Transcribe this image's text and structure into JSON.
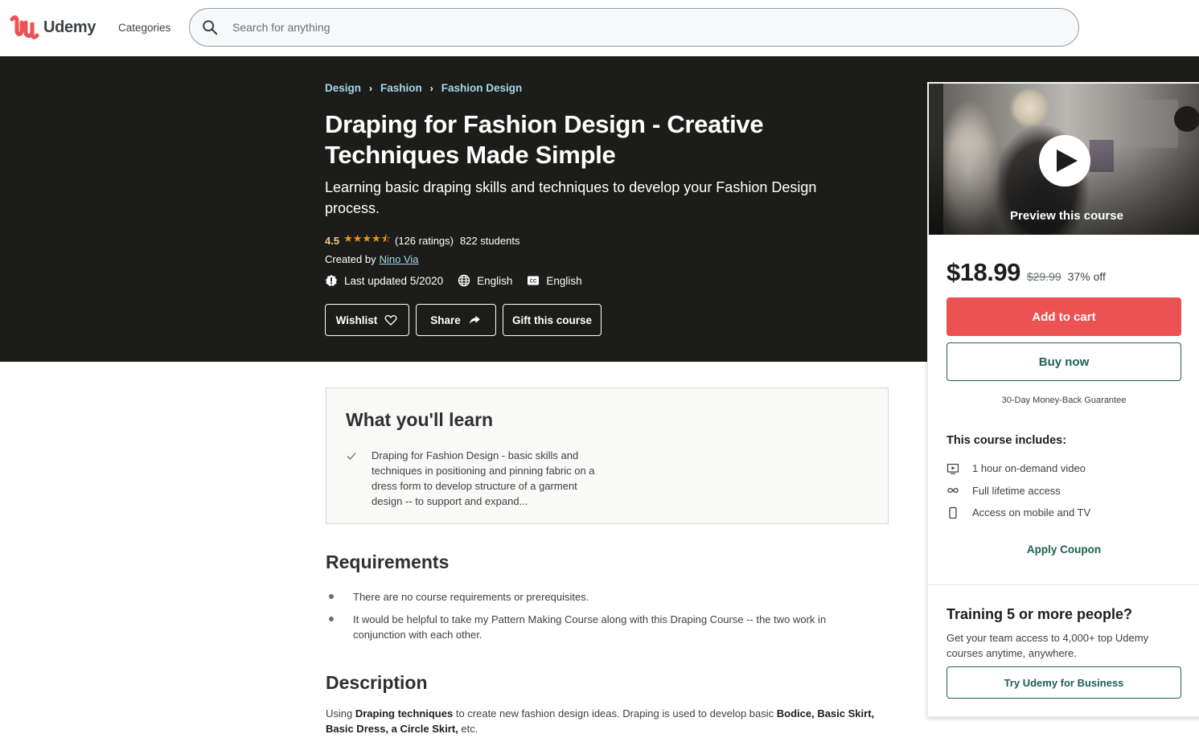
{
  "header": {
    "logo_text": "Udemy",
    "categories_label": "Categories",
    "search_placeholder": "Search for anything",
    "search_value": ""
  },
  "hero": {
    "breadcrumb": [
      "Design",
      "Fashion",
      "Fashion Design"
    ],
    "title": "Draping for Fashion Design - Creative Techniques Made Simple",
    "subtitle": "Learning basic draping skills and techniques to develop your Fashion Design process.",
    "rating": "4.5",
    "rating_value": 4.5,
    "rating_max": 5,
    "stars": "★★★★⯪",
    "ratings_count": "(126 ratings)",
    "students": "822 students",
    "created_by_label": "Created by",
    "instructor": "Nino Via",
    "last_updated": "Last updated 5/2020",
    "language": "English",
    "captions": "English",
    "buttons": {
      "wishlist": "Wishlist",
      "share": "Share",
      "gift": "Gift this course"
    }
  },
  "card": {
    "preview_label": "Preview this course",
    "price": "$18.99",
    "original_price": "$29.99",
    "discount": "37% off",
    "add_to_cart": "Add to cart",
    "buy_now": "Buy now",
    "guarantee": "30-Day Money-Back Guarantee",
    "includes_title": "This course includes:",
    "includes": [
      {
        "icon": "video-icon",
        "text": "1 hour on-demand video"
      },
      {
        "icon": "infinity-icon",
        "text": "Full lifetime access"
      },
      {
        "icon": "mobile-icon",
        "text": "Access on mobile and TV"
      }
    ],
    "apply_coupon": "Apply Coupon",
    "business_title": "Training 5 or more people?",
    "business_text": "Get your team access to 4,000+ top Udemy courses anytime, anywhere.",
    "business_button": "Try Udemy for Business"
  },
  "learn": {
    "title": "What you'll learn",
    "items": [
      "Draping for Fashion Design - basic skills and techniques in positioning and pinning fabric on a dress form to develop structure of a garment design -- to support and expand..."
    ]
  },
  "requirements": {
    "title": "Requirements",
    "items": [
      "There are no course requirements or prerequisites.",
      "It would be helpful to take my Pattern Making Course along with this Draping Course -- the two work in conjunction with each other."
    ]
  },
  "description": {
    "title": "Description",
    "parts": [
      {
        "text": "Using ",
        "bold": false
      },
      {
        "text": "Draping techniques",
        "bold": true
      },
      {
        "text": " to create new fashion design ideas.  Draping is used to develop basic ",
        "bold": false
      },
      {
        "text": "Bodice, Basic Skirt, Basic Dress, a Circle Skirt,",
        "bold": true
      },
      {
        "text": " etc.",
        "bold": false
      }
    ]
  },
  "colors": {
    "brand_red": "#ec5252",
    "dark_bg": "#1c1d1a",
    "link_light": "#a4d7ea",
    "teal": "#1e6055",
    "star": "#e59819"
  }
}
